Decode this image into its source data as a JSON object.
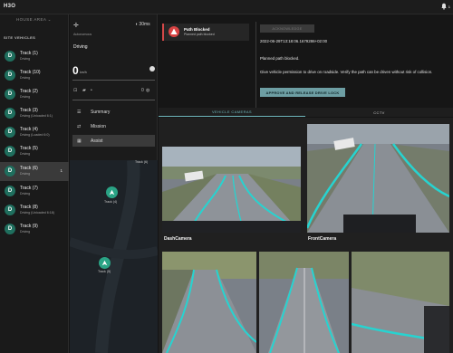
{
  "app": {
    "brand": "H3O",
    "notification_count": "1"
  },
  "sidebar": {
    "area_title": "HOUSE AREA",
    "section_title": "SITE VEHICLES",
    "vehicles": [
      {
        "avatar": "D",
        "name": "Track (1)",
        "status": "Driving"
      },
      {
        "avatar": "D",
        "name": "Track (10)",
        "status": "Driving"
      },
      {
        "avatar": "D",
        "name": "Track (2)",
        "status": "Driving"
      },
      {
        "avatar": "D",
        "name": "Track (3)",
        "status": "Driving (Unloaded 6:1)"
      },
      {
        "avatar": "D",
        "name": "Track (4)",
        "status": "Driving (Loaded 6:0)"
      },
      {
        "avatar": "D",
        "name": "Track (5)",
        "status": "Driving"
      },
      {
        "avatar": "D",
        "name": "Track (6)",
        "status": "Driving",
        "count": "1"
      },
      {
        "avatar": "D",
        "name": "Track (7)",
        "status": "Driving"
      },
      {
        "avatar": "D",
        "name": "Track (8)",
        "status": "Driving (Unloaded 6:18)"
      },
      {
        "avatar": "D",
        "name": "Track (9)",
        "status": "Driving"
      }
    ]
  },
  "vehicle_panel": {
    "mode": "Autonomous",
    "state": "Driving",
    "latency": "30ms",
    "speed": "0",
    "speed_unit": "km/h",
    "indicator_value": "0",
    "menu": [
      {
        "label": "Summary",
        "icon": "list-icon"
      },
      {
        "label": "Mission",
        "icon": "route-icon"
      },
      {
        "label": "Assist",
        "icon": "calendar-icon"
      }
    ],
    "map_labels": {
      "top": "Track (6)",
      "middle": "Track (4)",
      "bottom": "Track (5)"
    }
  },
  "alert": {
    "title": "Path Blocked",
    "subtitle": "Planned path blocked",
    "acknowledge_label": "ACKNOWLEDGE",
    "timestamp": "2022-06-29T13:18:06.1679286+02:00",
    "message": "Planned path blocked.",
    "instruction": "Give vehicle permission to drive on roadside. Verify the path can be driven without risk of collision.",
    "approve_label": "APPROVE AND RELEASE DRIVE LOCK"
  },
  "tabs": [
    {
      "label": "VEHICLE CAMERAS"
    },
    {
      "label": "CCTV"
    }
  ],
  "cameras": [
    {
      "label": "DashCamera"
    },
    {
      "label": "FrontCamera"
    }
  ],
  "colors": {
    "accent": "#2aa385",
    "alert": "#d84343",
    "approve": "#6d9ea3",
    "tab_active": "#6fb8bd"
  }
}
